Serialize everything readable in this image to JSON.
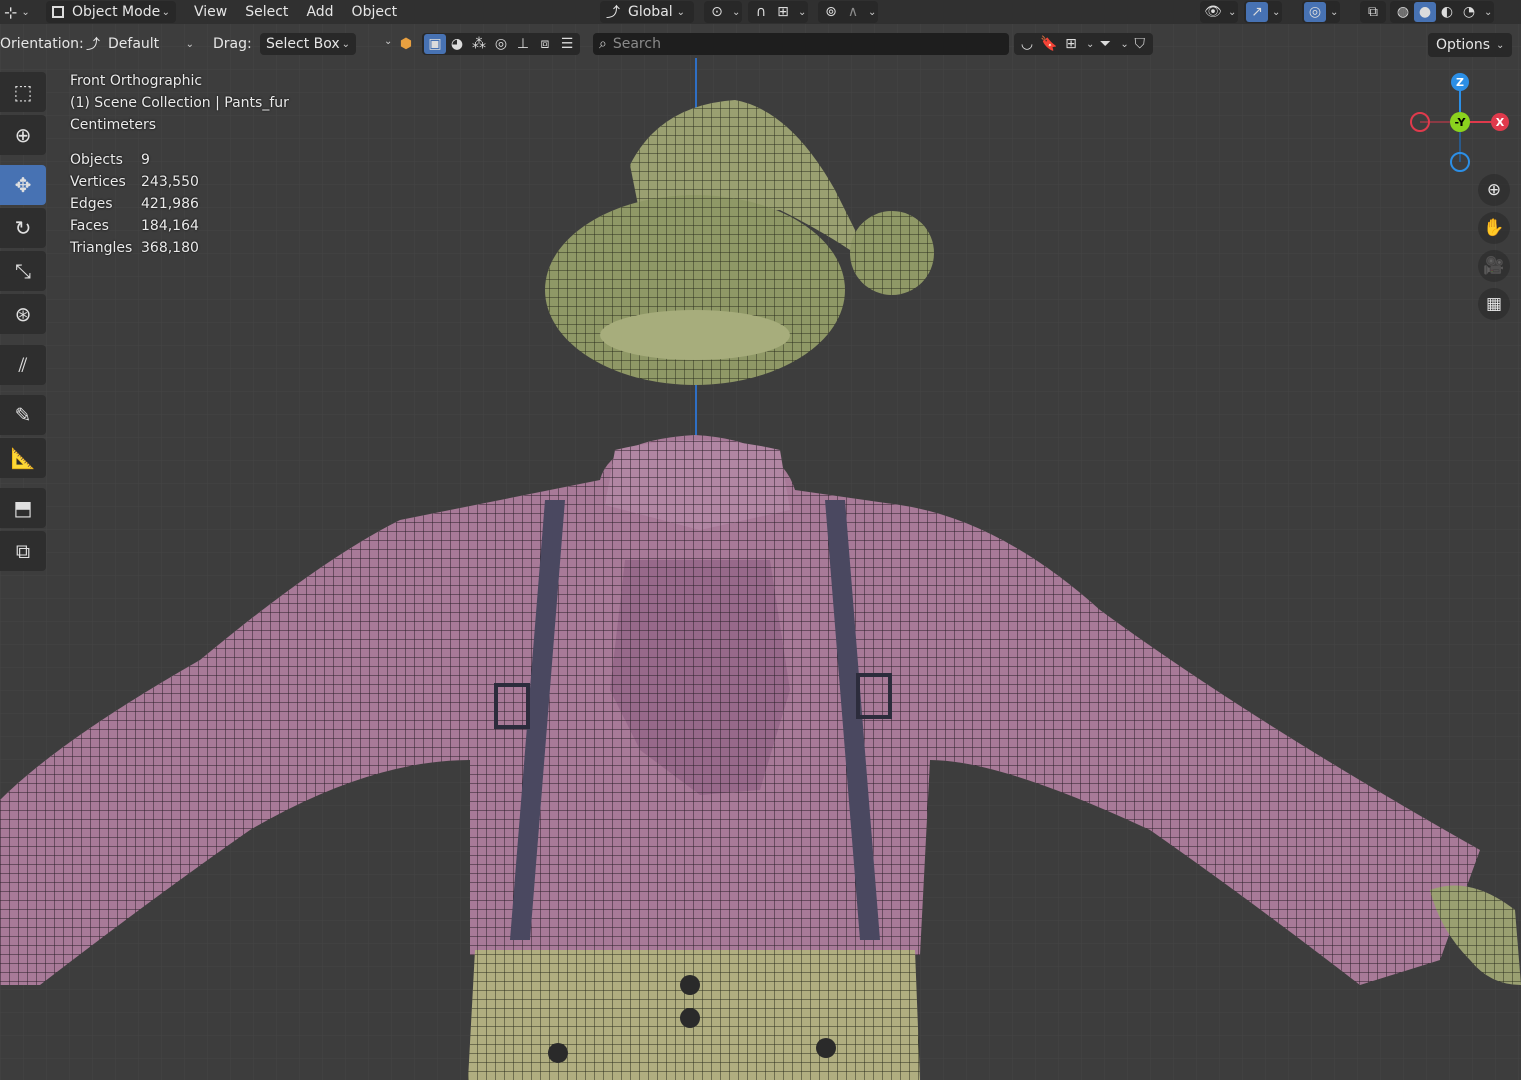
{
  "header": {
    "mode_label": "Object Mode",
    "menus": [
      "View",
      "Select",
      "Add",
      "Object"
    ],
    "transform_orientation": "Global"
  },
  "toolbar": {
    "orientation_label": "Orientation:",
    "orientation_value": "Default",
    "drag_label": "Drag:",
    "drag_value": "Select Box",
    "search_placeholder": "Search",
    "options_label": "Options"
  },
  "viewport": {
    "view_name": "Front Orthographic",
    "collection": "(1) Scene Collection | Pants_fur",
    "units": "Centimeters",
    "stats": [
      {
        "label": "Objects",
        "value": "9"
      },
      {
        "label": "Vertices",
        "value": "243,550"
      },
      {
        "label": "Edges",
        "value": "421,986"
      },
      {
        "label": "Faces",
        "value": "184,164"
      },
      {
        "label": "Triangles",
        "value": "368,180"
      }
    ]
  },
  "gizmo": {
    "z": "Z",
    "y": "-Y",
    "x": "X"
  },
  "colors": {
    "grid": "#3d3d3d",
    "header_bg": "#303030",
    "active_blue": "#4772b3",
    "shirt": "#a87a98",
    "hat": "#9aa071",
    "pants": "#b0ae80",
    "axis_x": "#e03a4c",
    "axis_y": "#8bd31e",
    "axis_z": "#2c8fe6"
  }
}
